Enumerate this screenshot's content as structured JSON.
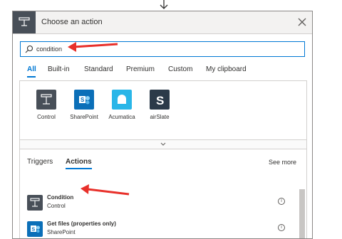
{
  "colors": {
    "accent": "#0078d4",
    "annotation_arrow": "#e8302a",
    "control_tile": "#484f58",
    "sharepoint_tile": "#0b6fb8",
    "acumatica_tile": "#29b6e8",
    "airslate_tile": "#2b3a49"
  },
  "dialog": {
    "title": "Choose an action",
    "close_icon": "close-icon"
  },
  "search": {
    "value": "condition",
    "placeholder": "",
    "icon": "search-icon"
  },
  "tabs": [
    "All",
    "Built-in",
    "Standard",
    "Premium",
    "Custom",
    "My clipboard"
  ],
  "active_tab": "All",
  "connectors": [
    {
      "label": "Control",
      "icon": "control-icon"
    },
    {
      "label": "SharePoint",
      "icon": "sharepoint-icon"
    },
    {
      "label": "Acumatica",
      "icon": "acumatica-icon"
    },
    {
      "label": "airSlate",
      "icon": "airslate-icon"
    }
  ],
  "subtabs": [
    "Triggers",
    "Actions"
  ],
  "active_subtab": "Actions",
  "see_more": "See more",
  "results": [
    {
      "title": "Condition",
      "subtitle": "Control",
      "icon": "control-icon"
    },
    {
      "title": "Get files (properties only)",
      "subtitle": "SharePoint",
      "icon": "sharepoint-icon"
    }
  ]
}
